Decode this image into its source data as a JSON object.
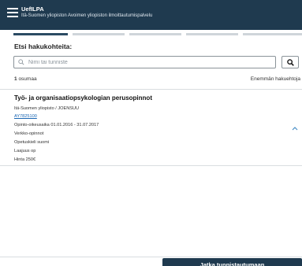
{
  "header": {
    "title": "UefILPA",
    "subtitle": "Itä-Suomen yliopiston Avoimen yliopiston ilmoittautumispalvelu",
    "menu_icon": "hamburger-icon"
  },
  "progress": {
    "total_steps": 5,
    "current_step": 1
  },
  "search": {
    "heading": "Etsi hakukohteita:",
    "placeholder": "Nimi tai tunniste",
    "value": "",
    "button_icon": "search-icon"
  },
  "results": {
    "count": "1",
    "count_label": "osumaa",
    "more_criteria": "Enemmän hakuehtoja"
  },
  "course": {
    "title": "Työ- ja organisaatiopsykologian perusopinnot",
    "organization": "Itä-Suomen yliopisto / JOENSUU",
    "code": "AY7825100",
    "period": "Opinto-oikeusaika 01.01.2016 - 31.07.2017",
    "mode": "Verkko-opinnot",
    "language": "Opetuskieli suomi",
    "scope": "Laajuus op",
    "price": "Hinta 250€",
    "toggle_icon": "chevron-up-icon"
  },
  "footer": {
    "continue_label": "Jatka tunnistautumaan"
  },
  "colors": {
    "header_bg": "#1f3a4f",
    "accent": "#2b4b63",
    "link": "#1a66b3"
  }
}
